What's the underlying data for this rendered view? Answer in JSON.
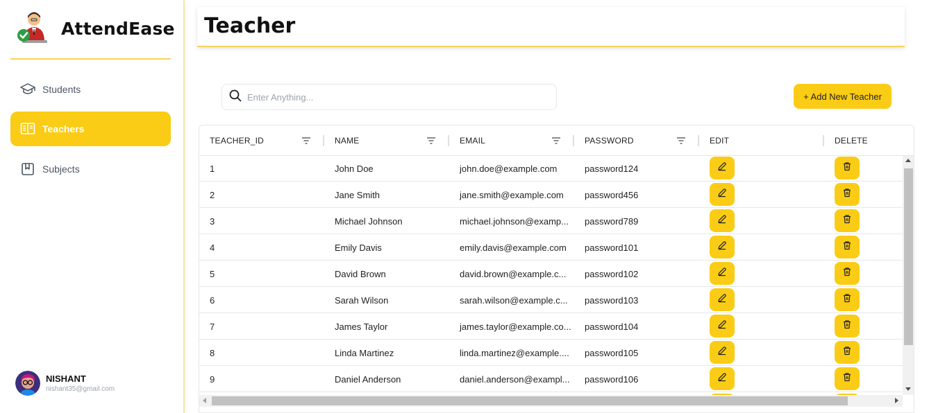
{
  "app": {
    "name": "AttendEase",
    "brand_color": "#facc15",
    "logo_icon": "teacher-avatar-checkmark-icon"
  },
  "sidebar": {
    "items": [
      {
        "label": "Students",
        "icon": "graduation-cap-icon",
        "active": false
      },
      {
        "label": "Teachers",
        "icon": "open-book-icon",
        "active": true
      },
      {
        "label": "Subjects",
        "icon": "bookmark-book-icon",
        "active": false
      }
    ],
    "user": {
      "name": "NISHANT",
      "email": "nishant35@gmail.com",
      "avatar_icon": "user-avatar-illustration"
    }
  },
  "header": {
    "title": "Teacher"
  },
  "toolbar": {
    "search_placeholder": "Enter Anything...",
    "search_value": "",
    "add_button_label": "+ Add New Teacher"
  },
  "table": {
    "columns": [
      {
        "label": "TEACHER_ID",
        "filter": true
      },
      {
        "label": "NAME",
        "filter": true
      },
      {
        "label": "EMAIL",
        "filter": true
      },
      {
        "label": "PASSWORD",
        "filter": true
      },
      {
        "label": "EDIT",
        "filter": false
      },
      {
        "label": "DELETE",
        "filter": false
      }
    ],
    "rows": [
      {
        "id": "1",
        "name": "John Doe",
        "email": "john.doe@example.com",
        "password": "password124"
      },
      {
        "id": "2",
        "name": "Jane Smith",
        "email": "jane.smith@example.com",
        "password": "password456"
      },
      {
        "id": "3",
        "name": "Michael Johnson",
        "email": "michael.johnson@examp...",
        "password": "password789"
      },
      {
        "id": "4",
        "name": "Emily Davis",
        "email": "emily.davis@example.com",
        "password": "password101"
      },
      {
        "id": "5",
        "name": "David Brown",
        "email": "david.brown@example.c...",
        "password": "password102"
      },
      {
        "id": "6",
        "name": "Sarah Wilson",
        "email": "sarah.wilson@example.c...",
        "password": "password103"
      },
      {
        "id": "7",
        "name": "James Taylor",
        "email": "james.taylor@example.co...",
        "password": "password104"
      },
      {
        "id": "8",
        "name": "Linda Martinez",
        "email": "linda.martinez@example....",
        "password": "password105"
      },
      {
        "id": "9",
        "name": "Daniel Anderson",
        "email": "daniel.anderson@exampl...",
        "password": "password106"
      }
    ],
    "edit_icon": "pencil-icon",
    "delete_icon": "trash-icon"
  }
}
